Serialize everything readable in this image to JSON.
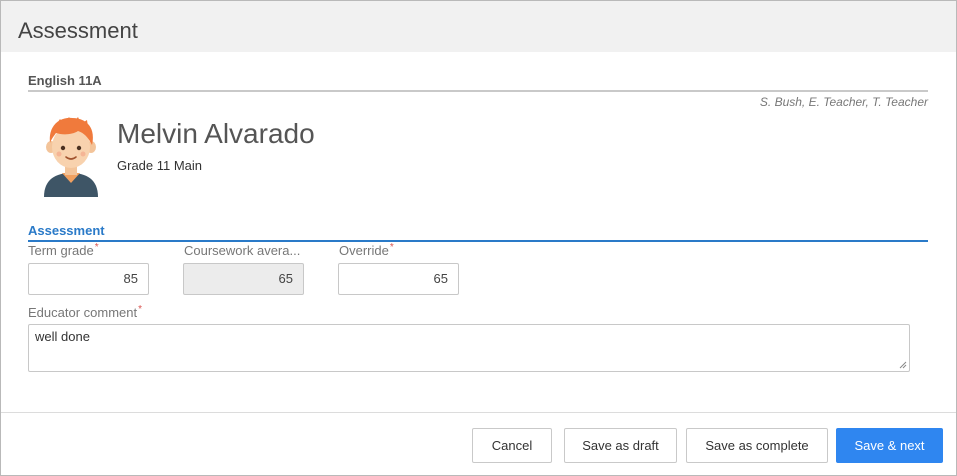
{
  "header": {
    "title": "Assessment"
  },
  "course": {
    "name": "English 11A",
    "teachers": "S. Bush, E. Teacher, T. Teacher"
  },
  "student": {
    "name": "Melvin Alvarado",
    "grade": "Grade 11 Main",
    "avatar_icon": "student-avatar-icon"
  },
  "assessment": {
    "section_label": "Assessment",
    "term_grade": {
      "label": "Term grade",
      "value": "85",
      "required_mark": "*"
    },
    "coursework_average": {
      "label": "Coursework avera...",
      "value": "65"
    },
    "override": {
      "label": "Override",
      "value": "65",
      "required_mark": "*"
    },
    "educator_comment": {
      "label": "Educator comment",
      "value": "well done",
      "required_mark": "*"
    }
  },
  "footer": {
    "cancel_label": "Cancel",
    "save_draft_label": "Save as draft",
    "save_complete_label": "Save as complete",
    "save_next_label": "Save & next"
  },
  "colors": {
    "accent": "#2a7ac8",
    "primary_button": "#2f86f0",
    "required": "#d9534f"
  }
}
